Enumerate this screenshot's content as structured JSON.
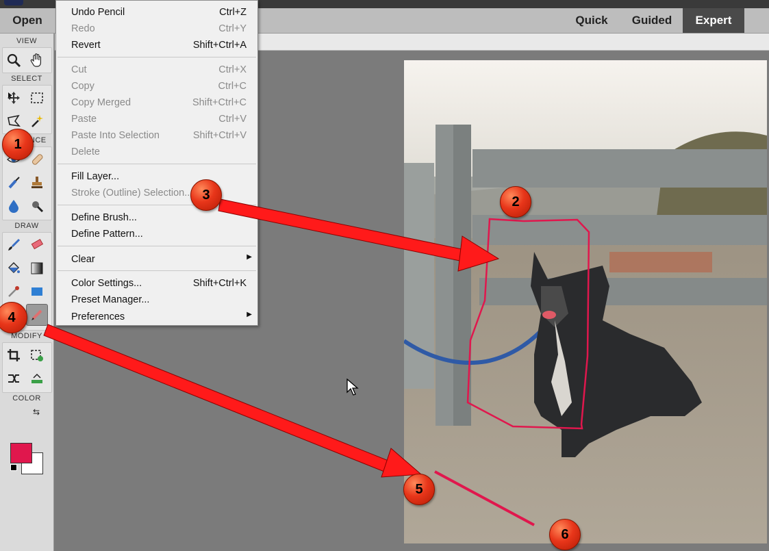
{
  "app": {
    "open_label": "Open",
    "modes": [
      "Quick",
      "Guided",
      "Expert"
    ],
    "active_mode": "Expert"
  },
  "toolbox": {
    "sections": {
      "view": "VIEW",
      "select": "SELECT",
      "enhance": "ENHANCE",
      "draw": "DRAW",
      "modify": "MODIFY",
      "color": "COLOR"
    },
    "foreground_color": "#e0174d",
    "background_color": "#ffffff"
  },
  "edit_menu": {
    "items": [
      {
        "label": "Undo Pencil",
        "shortcut": "Ctrl+Z",
        "enabled": true
      },
      {
        "label": "Redo",
        "shortcut": "Ctrl+Y",
        "enabled": false
      },
      {
        "label": "Revert",
        "shortcut": "Shift+Ctrl+A",
        "enabled": true
      },
      {
        "label": "Cut",
        "shortcut": "Ctrl+X",
        "enabled": false
      },
      {
        "label": "Copy",
        "shortcut": "Ctrl+C",
        "enabled": false
      },
      {
        "label": "Copy Merged",
        "shortcut": "Shift+Ctrl+C",
        "enabled": false
      },
      {
        "label": "Paste",
        "shortcut": "Ctrl+V",
        "enabled": false
      },
      {
        "label": "Paste Into Selection",
        "shortcut": "Shift+Ctrl+V",
        "enabled": false
      },
      {
        "label": "Delete",
        "shortcut": "",
        "enabled": false
      },
      {
        "label": "Fill Layer...",
        "shortcut": "",
        "enabled": true
      },
      {
        "label": "Stroke (Outline) Selection...",
        "shortcut": "",
        "enabled": false
      },
      {
        "label": "Define Brush...",
        "shortcut": "",
        "enabled": true
      },
      {
        "label": "Define Pattern...",
        "shortcut": "",
        "enabled": true
      },
      {
        "label": "Clear",
        "shortcut": "",
        "enabled": true,
        "submenu": true
      },
      {
        "label": "Color Settings...",
        "shortcut": "Shift+Ctrl+K",
        "enabled": true
      },
      {
        "label": "Preset Manager...",
        "shortcut": "",
        "enabled": true
      },
      {
        "label": "Preferences",
        "shortcut": "",
        "enabled": true,
        "submenu": true
      }
    ]
  },
  "annotations": [
    "1",
    "2",
    "3",
    "4",
    "5",
    "6"
  ],
  "accent_color": "#e8361a",
  "stroke_color": "#e0174d"
}
